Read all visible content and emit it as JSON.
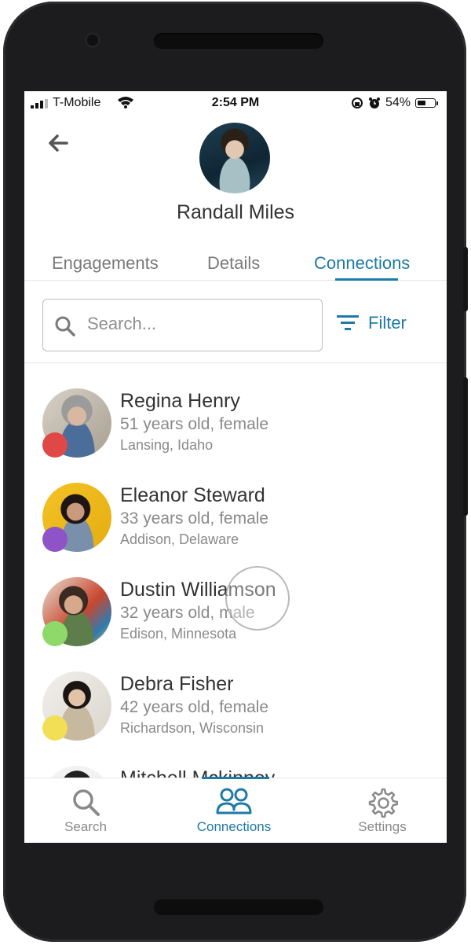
{
  "status_bar": {
    "carrier": "T-Mobile",
    "time": "2:54 PM",
    "battery": "54%",
    "battery_level": 0.54
  },
  "profile": {
    "name": "Randall Miles"
  },
  "tabs": [
    {
      "label": "Engagements",
      "active": false
    },
    {
      "label": "Details",
      "active": false
    },
    {
      "label": "Connections",
      "active": true
    }
  ],
  "search": {
    "placeholder": "Search...",
    "value": ""
  },
  "filter": {
    "label": "Filter"
  },
  "connections": [
    {
      "name": "Regina Henry",
      "details": "51 years old, female",
      "location": "Lansing, Idaho",
      "dot_color": "#e04848"
    },
    {
      "name": "Eleanor Steward",
      "details": "33 years old, female",
      "location": "Addison, Delaware",
      "dot_color": "#8e54c7"
    },
    {
      "name": "Dustin Williamson",
      "details": "32 years old, male",
      "location": "Edison, Minnesota",
      "dot_color": "#8fd86a"
    },
    {
      "name": "Debra Fisher",
      "details": "42 years old, female",
      "location": "Richardson, Wisconsin",
      "dot_color": "#f2df55"
    },
    {
      "name": "Mitchell Mckinney",
      "details": "",
      "location": "",
      "dot_color": ""
    }
  ],
  "bottom_nav": [
    {
      "label": "Search",
      "icon": "search-icon",
      "active": false
    },
    {
      "label": "Connections",
      "icon": "people-icon",
      "active": true
    },
    {
      "label": "Settings",
      "icon": "gear-icon",
      "active": false
    }
  ],
  "colors": {
    "accent": "#1e7aa6",
    "text": "#333333",
    "muted": "#8a8a8a"
  }
}
